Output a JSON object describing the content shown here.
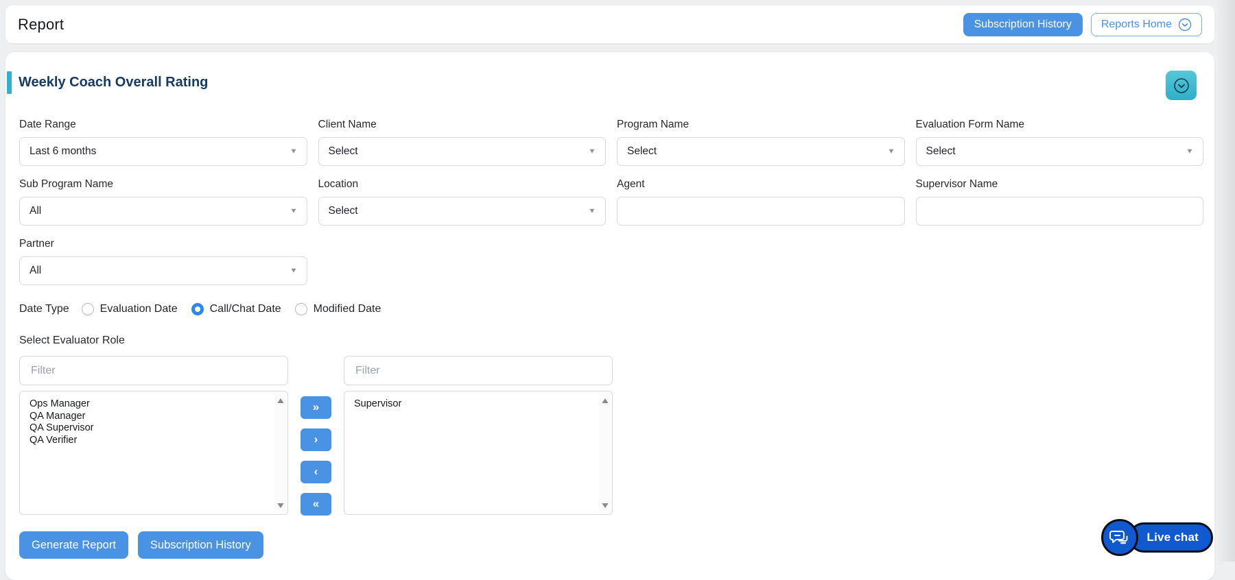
{
  "header": {
    "title": "Report",
    "subscription_history_label": "Subscription History",
    "reports_home_label": "Reports Home"
  },
  "panel": {
    "title": "Weekly Coach Overall Rating",
    "accent_color": "#2fb3cc",
    "title_color": "#173a63"
  },
  "colors": {
    "primary_button": "#4a92e4",
    "radio_selected": "#2e86f0",
    "collapse_button": "#3ab7ce",
    "live_chat_blue": "#1159cf",
    "page_background": "#edeff1"
  },
  "filters": {
    "fields": [
      {
        "label": "Date Range",
        "type": "select",
        "value": "Last 6 months"
      },
      {
        "label": "Client Name",
        "type": "select",
        "value": "Select"
      },
      {
        "label": "Program Name",
        "type": "select",
        "value": "Select"
      },
      {
        "label": "Evaluation Form Name",
        "type": "select",
        "value": "Select"
      },
      {
        "label": "Sub Program Name",
        "type": "select",
        "value": "All"
      },
      {
        "label": "Location",
        "type": "select",
        "value": "Select"
      },
      {
        "label": "Agent",
        "type": "text",
        "value": ""
      },
      {
        "label": "Supervisor Name",
        "type": "text",
        "value": ""
      },
      {
        "label": "Partner",
        "type": "select",
        "value": "All"
      }
    ],
    "date_type": {
      "label": "Date Type",
      "options": [
        {
          "label": "Evaluation Date",
          "selected": false
        },
        {
          "label": "Call/Chat Date",
          "selected": true
        },
        {
          "label": "Modified Date",
          "selected": false
        }
      ]
    },
    "evaluator_role": {
      "label": "Select Evaluator Role",
      "filter_placeholder": "Filter",
      "available": [
        "Ops Manager",
        "QA Manager",
        "QA Supervisor",
        "QA Verifier"
      ],
      "selected": [
        "Supervisor"
      ],
      "transfer_buttons": [
        {
          "glyph": "»",
          "name": "move-all-right-button"
        },
        {
          "glyph": "›",
          "name": "move-right-button"
        },
        {
          "glyph": "‹",
          "name": "move-left-button"
        },
        {
          "glyph": "«",
          "name": "move-all-left-button"
        }
      ]
    },
    "actions": {
      "generate": "Generate Report",
      "subscription": "Subscription History"
    }
  },
  "live_chat": {
    "label": "Live chat"
  }
}
